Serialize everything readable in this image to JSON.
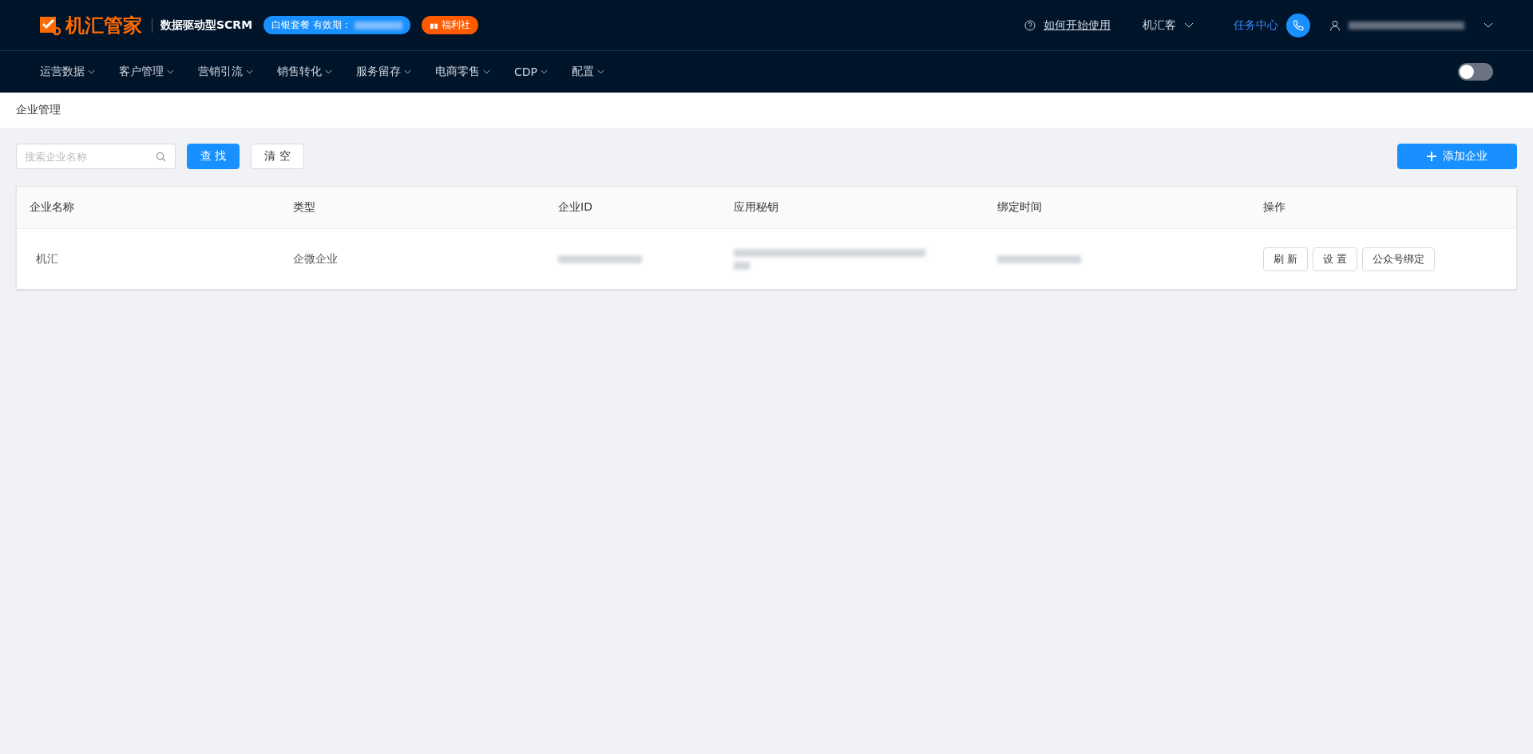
{
  "header": {
    "logo": "机汇管家",
    "tagline": "数据驱动型SCRM",
    "plan_badge": {
      "label": "白银套餐  有效期："
    },
    "welfare_badge": "福利社",
    "help_link": "如何开始使用",
    "account_menu": "机汇客",
    "task_center": "任务中心"
  },
  "nav": {
    "items": [
      {
        "label": "运营数据"
      },
      {
        "label": "客户管理"
      },
      {
        "label": "营销引流"
      },
      {
        "label": "销售转化"
      },
      {
        "label": "服务留存"
      },
      {
        "label": "电商零售"
      },
      {
        "label": "CDP"
      },
      {
        "label": "配置"
      }
    ],
    "toggle": {
      "on": false
    }
  },
  "breadcrumb": "企业管理",
  "toolbar": {
    "search": {
      "placeholder": "搜索企业名称"
    },
    "buttons": [
      "查 找",
      "清 空"
    ],
    "add_button": "添加企业"
  },
  "table": {
    "columns": [
      "企业名称",
      "类型",
      "企业ID",
      "应用秘钥",
      "绑定时间",
      "操作"
    ],
    "rows": [
      {
        "cells": [
          {
            "text": "机汇"
          },
          {
            "text": "企微企业"
          }
        ],
        "actions": [
          "刷 新",
          "设 置",
          "公众号绑定"
        ]
      }
    ]
  }
}
